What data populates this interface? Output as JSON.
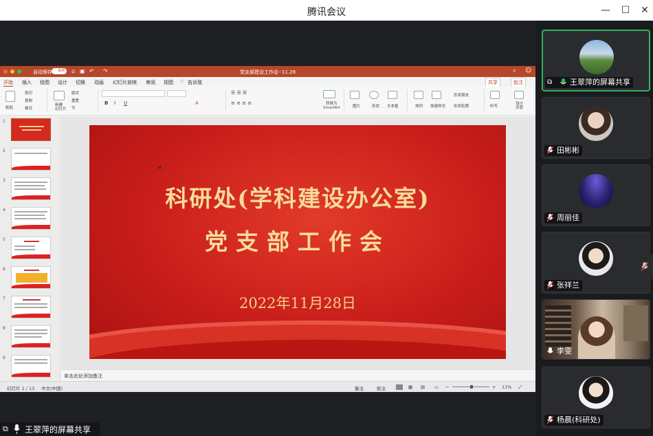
{
  "app": {
    "title": "腾讯会议"
  },
  "ppt": {
    "doc_title": "党支部建设工作会--11.28",
    "autosave_label": "自动保存",
    "autosave_state": "关闭",
    "tabs": [
      "开始",
      "插入",
      "绘图",
      "设计",
      "切换",
      "动画",
      "幻灯片放映",
      "审阅",
      "视图",
      "告诉我"
    ],
    "share_btn": "共享",
    "comment_btn": "批注",
    "ribbon": {
      "paste": "粘贴",
      "cut": "剪切",
      "copy": "复制",
      "format": "格式",
      "new_slide": "新建\n幻灯片",
      "layout": "版式",
      "reset": "重置",
      "section": "节",
      "smartart": "转换为\nSmartArt",
      "picture": "图片",
      "shapes": "形状",
      "textbox": "文本框",
      "arrange": "排列",
      "quick_styles": "快速样式",
      "shape_fill": "形状填充",
      "shape_outline": "形状轮廓",
      "dictate": "听写",
      "designer": "设计\n灵感"
    },
    "slide": {
      "line1": "科研处(学科建设办公室)",
      "line2": "党支部工作会",
      "date": "2022年11月28日"
    },
    "thumb_numbers": [
      "1",
      "2",
      "3",
      "4",
      "5",
      "6",
      "7",
      "8",
      "9"
    ],
    "notes_placeholder": "单击此处添加备注",
    "status": {
      "slide_count": "幻灯片 1 / 13",
      "language": "中文(中国)",
      "notes": "备注",
      "comments": "批注",
      "zoom": "11%"
    }
  },
  "share_label": "王翠萍的屏幕共享",
  "participants": [
    {
      "name": "王翠萍的屏幕共享",
      "active": true,
      "muted": false
    },
    {
      "name": "田彬彬",
      "active": false,
      "muted": true
    },
    {
      "name": "周丽佳",
      "active": false,
      "muted": true
    },
    {
      "name": "张祥兰",
      "active": false,
      "muted": true
    },
    {
      "name": "李雯",
      "active": false,
      "muted": false
    },
    {
      "name": "杨晨(科研处)",
      "active": false,
      "muted": true
    }
  ],
  "colors": {
    "ppt_accent": "#b7472a",
    "active_border": "#2fb35b",
    "mic_muted": "#e0453a",
    "slide_text": "#f7dc9a"
  }
}
